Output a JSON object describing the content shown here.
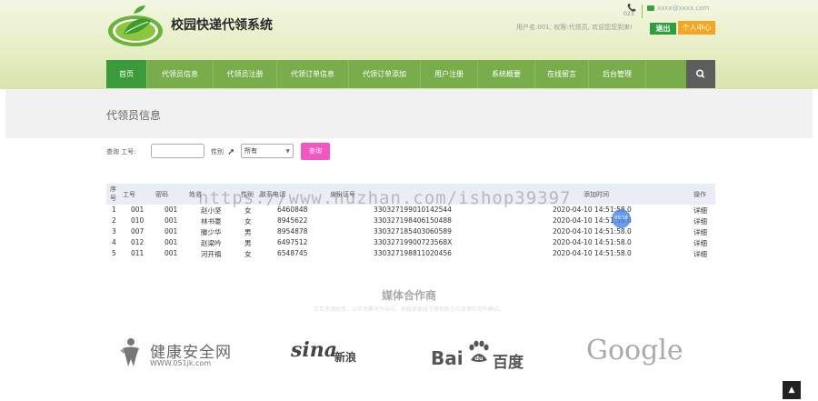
{
  "header": {
    "site_title": "校园快递代领系统",
    "phone": "023",
    "email": "xxxx@xxxx.com",
    "user_info": "用户名:001; 权限:代领员, 欢迎您您到来!",
    "logout_label": "退出",
    "personal_center_label": "个人中心"
  },
  "nav": {
    "items": [
      {
        "label": "首页"
      },
      {
        "label": "代领员信息"
      },
      {
        "label": "代领员注册"
      },
      {
        "label": "代领订单信息"
      },
      {
        "label": "代领订单添加"
      },
      {
        "label": "用户注册"
      },
      {
        "label": "系统概要"
      },
      {
        "label": "在线留言"
      },
      {
        "label": "后台管理"
      }
    ],
    "search_icon": "search-icon"
  },
  "page": {
    "heading": "代领员信息"
  },
  "query": {
    "label_id": "查询 工号:",
    "id_value": "",
    "label_gender": "性别",
    "gender_selected": "所有",
    "search_label": "查询"
  },
  "table": {
    "headers": {
      "seq": "序号",
      "id": "工号",
      "password": "密码",
      "name": "姓名",
      "gender": "性别",
      "phone": "联系电话",
      "idcard": "身份证号",
      "added": "添加时间",
      "action": "操作"
    },
    "rows": [
      {
        "seq": "1",
        "id": "001",
        "password": "001",
        "name": "赵小坚",
        "gender": "女",
        "phone": "6460848",
        "idcard": "330327199010142544",
        "added": "2020-04-10 14:51:58.0",
        "action": "详细"
      },
      {
        "seq": "2",
        "id": "010",
        "password": "001",
        "name": "林书豪",
        "gender": "女",
        "phone": "8945622",
        "idcard": "330327198406150488",
        "added": "2020-04-10 14:51:58.0",
        "action": "详细"
      },
      {
        "seq": "3",
        "id": "007",
        "password": "001",
        "name": "滕少华",
        "gender": "男",
        "phone": "8954878",
        "idcard": "330327185403060589",
        "added": "2020-04-10 14:51:58.0",
        "action": "详细"
      },
      {
        "seq": "4",
        "id": "012",
        "password": "001",
        "name": "赵梁吟",
        "gender": "男",
        "phone": "6497512",
        "idcard": "33032719900723568X",
        "added": "2020-04-10 14:51:58.0",
        "action": "详细"
      },
      {
        "seq": "5",
        "id": "011",
        "password": "001",
        "name": "河开禛",
        "gender": "女",
        "phone": "6548745",
        "idcard": "330327198811020456",
        "added": "2020-04-10 14:51:58.0",
        "action": "详细"
      }
    ]
  },
  "watermark": "https://www.huzhan.com/ishop39397",
  "badge": "00:18",
  "media": {
    "title": "媒体合作商",
    "subtitle": "立足资源优势，以市场需求为导向，积极探索线下营销能力与效率的合作模式。",
    "partners": {
      "jk_name": "健康安全网",
      "jk_url": "WWW.051jk.com",
      "sina_latin": "sina",
      "sina_cn": "新浪",
      "baidu_latin": "Bai",
      "baidu_paw": "du",
      "baidu_cn": "百度",
      "google": "Google"
    }
  },
  "back_to_top": "▲"
}
